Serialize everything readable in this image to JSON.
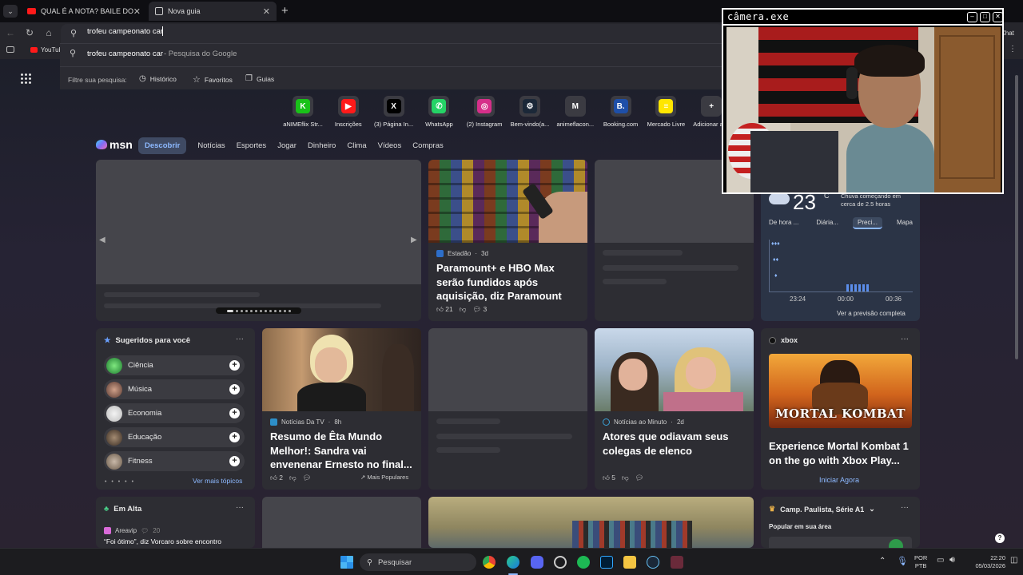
{
  "tabs": [
    {
      "title": "QUAL É A NOTA? BAILE DO CASIM"
    },
    {
      "title": "Nova guia"
    }
  ],
  "omnibox": {
    "value": "trofeu campeonato car"
  },
  "suggestion": {
    "text": "trofeu campeonato car",
    "suffix": " - Pesquisa do Google"
  },
  "filter": {
    "label": "Filtre sua pesquisa:",
    "history": "Histórico",
    "favorites": "Favoritos",
    "guides": "Guias"
  },
  "bookmarks": {
    "youtube": "YouTub",
    "chat": "Chat"
  },
  "shortcuts": [
    {
      "label": "aNIMEflix Str...",
      "glyph": "K",
      "color": "#19c219"
    },
    {
      "label": "Inscrições",
      "glyph": "▶",
      "color": "#ff1a1a"
    },
    {
      "label": "(3) Página In...",
      "glyph": "X",
      "color": "#000000"
    },
    {
      "label": "WhatsApp",
      "glyph": "✆",
      "color": "#25d366"
    },
    {
      "label": "(2) Instagram",
      "glyph": "◎",
      "color": "#d62f8a"
    },
    {
      "label": "Bem-vindo(a...",
      "glyph": "⚙",
      "color": "#1b2838"
    },
    {
      "label": "animeflacon...",
      "glyph": "M",
      "color": "#3b3b42"
    },
    {
      "label": "Booking.com",
      "glyph": "B.",
      "color": "#1e4fa8"
    },
    {
      "label": "Mercado Livre",
      "glyph": "≡",
      "color": "#ffe600"
    },
    {
      "label": "Adicionar at...",
      "glyph": "+",
      "color": "#3b3b42"
    }
  ],
  "msn": {
    "logo": "msn",
    "nav": [
      "Descobrir",
      "Notícias",
      "Esportes",
      "Jogar",
      "Dinheiro",
      "Clima",
      "Vídeos",
      "Compras"
    ]
  },
  "news1": {
    "source": "Estadão",
    "age": "3d",
    "headline": "Paramount+ e HBO Max serão fundidos após aquisição, diz Paramount",
    "likes": "21",
    "comments": "3"
  },
  "weather": {
    "temp": "23",
    "unit": "C",
    "alert": "Chuva começando em cerca de 2.5 horas",
    "tabs": [
      "De hora ...",
      "Diária...",
      "Preci...",
      "Mapa"
    ],
    "times": [
      "23:24",
      "00:00",
      "00:36"
    ],
    "link": "Ver a previsão completa"
  },
  "suggested": {
    "title": "Sugeridos para você",
    "topics": [
      "Ciência",
      "Música",
      "Economia",
      "Educação",
      "Fitness"
    ],
    "more": "Ver mais tópicos"
  },
  "news2": {
    "source": "Notícias Da TV",
    "age": "8h",
    "headline": "Resumo de Êta Mundo Melhor!: Sandra vai envenenar Ernesto no final...",
    "likes": "2",
    "popular": "Mais Populares"
  },
  "news3": {
    "source": "Notícias ao Minuto",
    "age": "2d",
    "headline": "Atores que odiavam seus colegas de elenco",
    "likes": "5"
  },
  "xbox": {
    "label": "xbox",
    "game_title": "MORTAL KOMBAT",
    "headline": "Experience Mortal Kombat 1 on the go with Xbox Play...",
    "cta": "Iniciar Agora"
  },
  "trending": {
    "title": "Em Alta",
    "source": "Areavip",
    "count": "20",
    "text": "“Foi ótimo”, diz Vorcaro sobre encontro"
  },
  "sports": {
    "title": "Camp. Paulista, Série A1",
    "subtitle": "Popular em sua área"
  },
  "camera": {
    "title": "câmera.exe"
  },
  "taskbar": {
    "search": "Pesquisar",
    "lang1": "POR",
    "lang2": "PTB",
    "time": "22:20",
    "date": "05/03/2026"
  }
}
